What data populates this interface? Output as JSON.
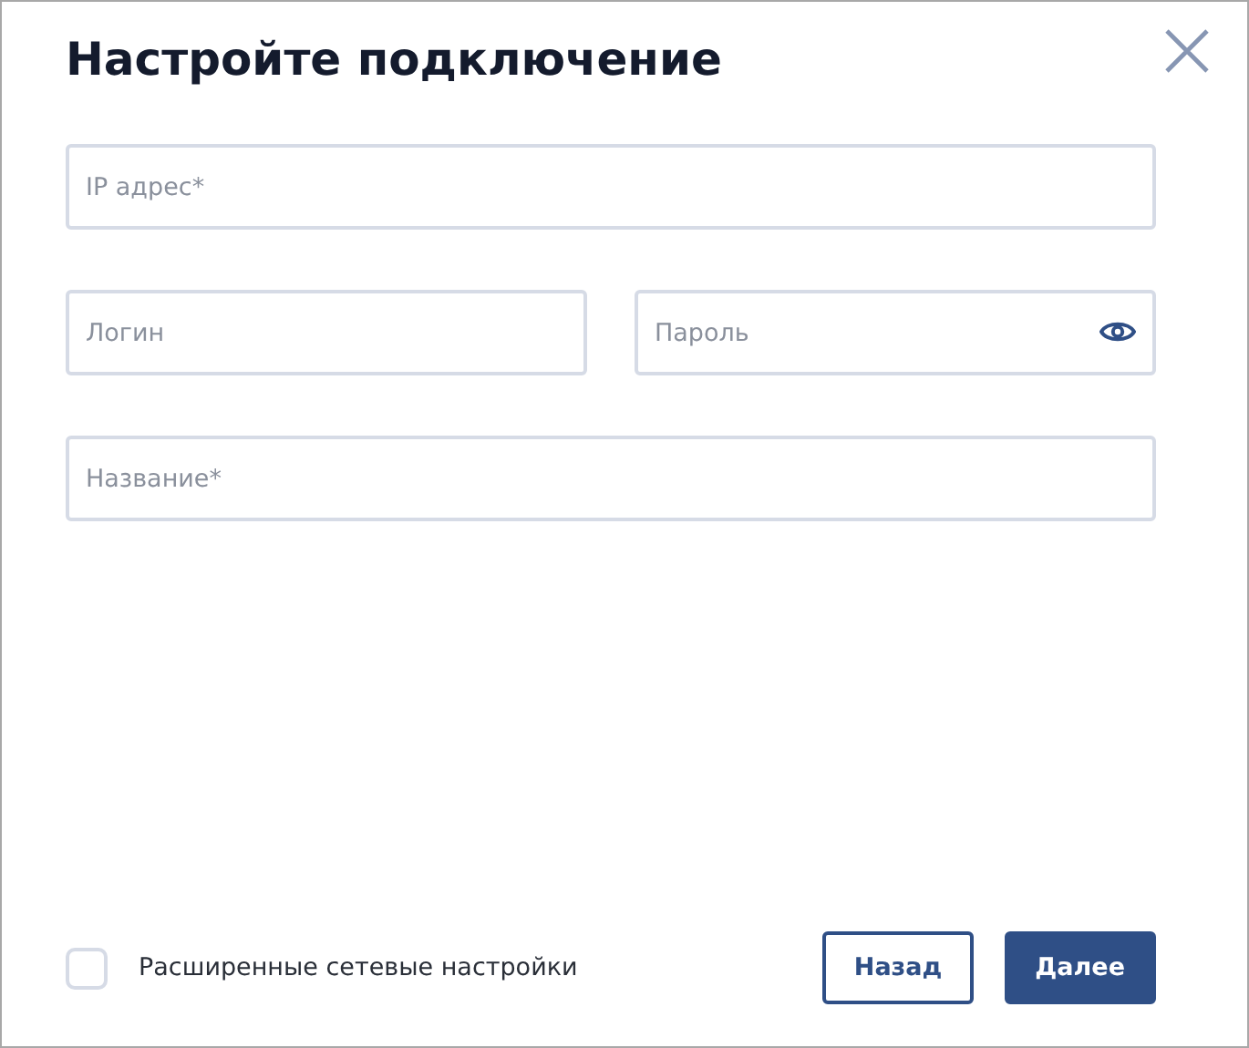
{
  "dialog": {
    "title": "Настройте подключение"
  },
  "field_rows": [
    [
      {
        "placeholder": "IP адрес*",
        "kind": "text"
      }
    ],
    [
      {
        "placeholder": "Логин",
        "kind": "text"
      },
      {
        "placeholder": "Пароль",
        "kind": "password"
      }
    ],
    [
      {
        "placeholder": "Название*",
        "kind": "text"
      }
    ]
  ],
  "advanced": {
    "label": "Расширенные сетевые настройки",
    "checked": false
  },
  "buttons": [
    {
      "label": "Назад",
      "kind": "secondary"
    },
    {
      "label": "Далее",
      "kind": "primary"
    }
  ]
}
